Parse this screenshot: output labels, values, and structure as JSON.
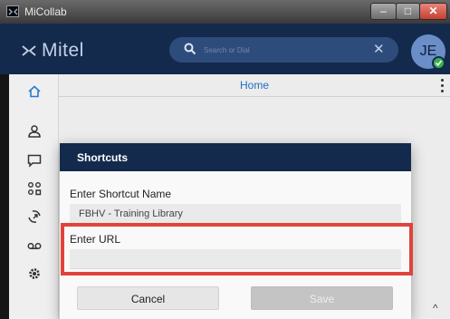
{
  "window": {
    "title": "MiCollab",
    "minimize": "–",
    "maximize": "□",
    "close": "✕"
  },
  "header": {
    "logo_text": "Mitel",
    "search_placeholder": "Search or Dial",
    "search_value": "",
    "clear_glyph": "✕",
    "avatar_initials": "JE",
    "presence_status": "available",
    "accent": "#142a4d"
  },
  "sidebar": {
    "items": [
      {
        "icon": "home-icon"
      },
      {
        "icon": "contacts-icon"
      },
      {
        "icon": "chat-icon"
      },
      {
        "icon": "groups-icon"
      },
      {
        "icon": "call-history-icon"
      },
      {
        "icon": "voicemail-icon"
      },
      {
        "icon": "settings-icon"
      }
    ]
  },
  "main": {
    "title": "Home",
    "scroll_glyph": "^"
  },
  "dialog": {
    "title": "Shortcuts",
    "name_label": "Enter Shortcut Name",
    "name_value": "FBHV - Training Library",
    "url_label": "Enter URL",
    "url_value": "",
    "cancel_label": "Cancel",
    "save_label": "Save",
    "highlight_color": "#e0433b"
  }
}
